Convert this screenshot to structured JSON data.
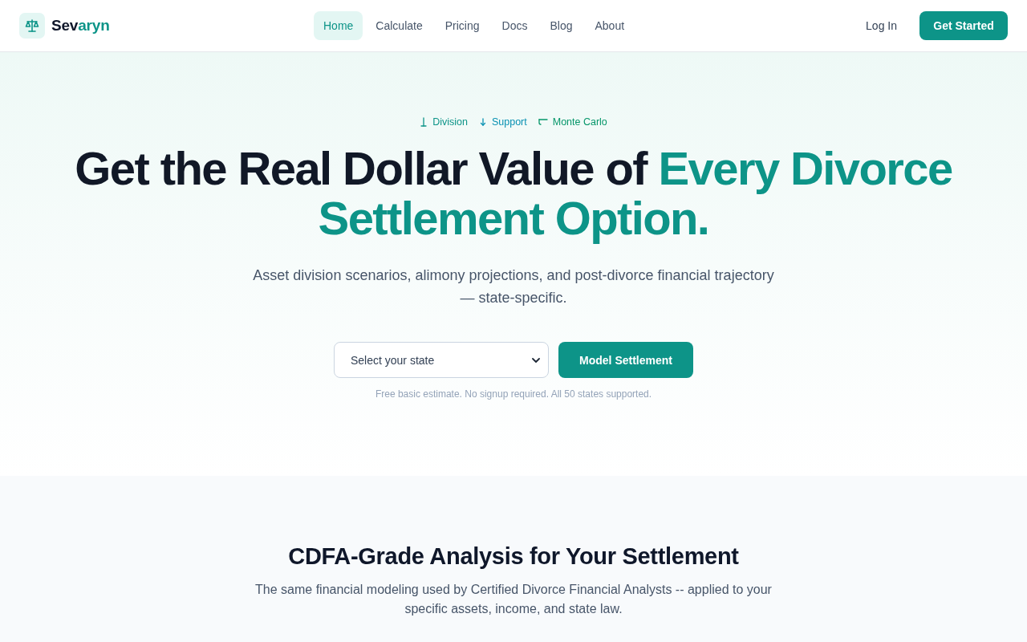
{
  "brand": {
    "lead": "Sev",
    "highlight": "aryn"
  },
  "nav": {
    "links": [
      {
        "label": "Home",
        "selected": true
      },
      {
        "label": "Calculate",
        "selected": false
      },
      {
        "label": "Pricing",
        "selected": false
      },
      {
        "label": "Docs",
        "selected": false
      },
      {
        "label": "Blog",
        "selected": false
      },
      {
        "label": "About",
        "selected": false
      }
    ],
    "login": "Log In",
    "cta": "Get Started"
  },
  "hero": {
    "tags": [
      {
        "label": "Division",
        "color": "#0d9488"
      },
      {
        "label": "Support",
        "color": "#0891b2"
      },
      {
        "label": "Monte Carlo",
        "color": "#059669"
      }
    ],
    "headline_lead": "Get the Real Dollar Value of",
    "headline_highlight": "Every Divorce Settlement Option.",
    "subtitle": "Asset division scenarios, alimony projections, and post-divorce financial trajectory — state-specific.",
    "state_select": {
      "placeholder": "Select your state"
    },
    "submit": "Model Settlement",
    "note": "Free basic estimate. No signup required. All 50 states supported."
  },
  "analysis": {
    "title": "CDFA-Grade Analysis for Your Settlement",
    "description": "The same financial modeling used by Certified Divorce Financial Analysts -- applied to your specific assets, income, and state law."
  }
}
